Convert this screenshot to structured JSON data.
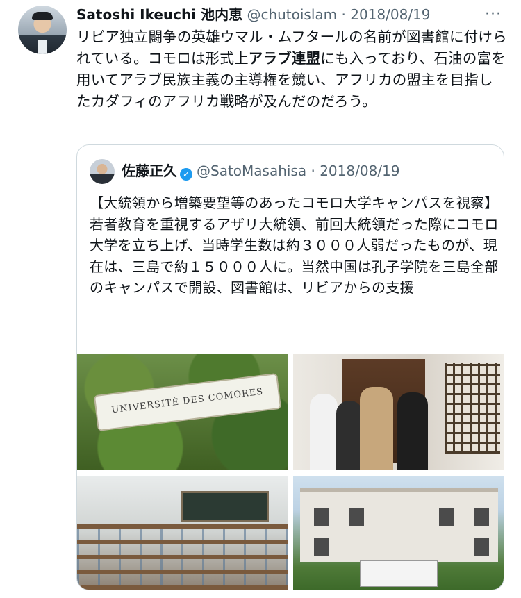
{
  "tweet": {
    "author_name": "Satoshi Ikeuchi 池内恵",
    "handle": "@chutoislam",
    "separator": "·",
    "date": "2018/08/19",
    "more_label": "···",
    "text_part1": "リビア独立闘争の英雄ウマル・ムフタールの名前が図書館に付けられている。コモロは形式上",
    "text_bold": "アラブ連盟",
    "text_part2": "にも入っており、石油の富を用いてアラブ民族主義の主導権を競い、アフリカの盟主を目指したカダフィのアフリカ戦略が及んだのだろう。"
  },
  "quote": {
    "author_name": "佐藤正久",
    "verified_mark": "✓",
    "handle": "@SatoMasahisa",
    "separator": "·",
    "date": "2018/08/19",
    "text": "【大統領から増築要望等のあったコモロ大学キャンパスを視察】\n若者教育を重視するアザリ大統領、前回大統領だった際にコモロ大学を立ち上げ、当時学生数は約３０００人弱だったものが、現在は、三島で約１５０００人に。当然中国は孔子学院を三島全部のキャンパスで開設、図書館は、リビアからの支援",
    "images": [
      {
        "name": "university-sign-photo",
        "sign_text": "UNIVERSITÉ DES COMORES"
      },
      {
        "name": "library-entrance-photo"
      },
      {
        "name": "classroom-photo"
      },
      {
        "name": "campus-building-photo"
      }
    ]
  }
}
